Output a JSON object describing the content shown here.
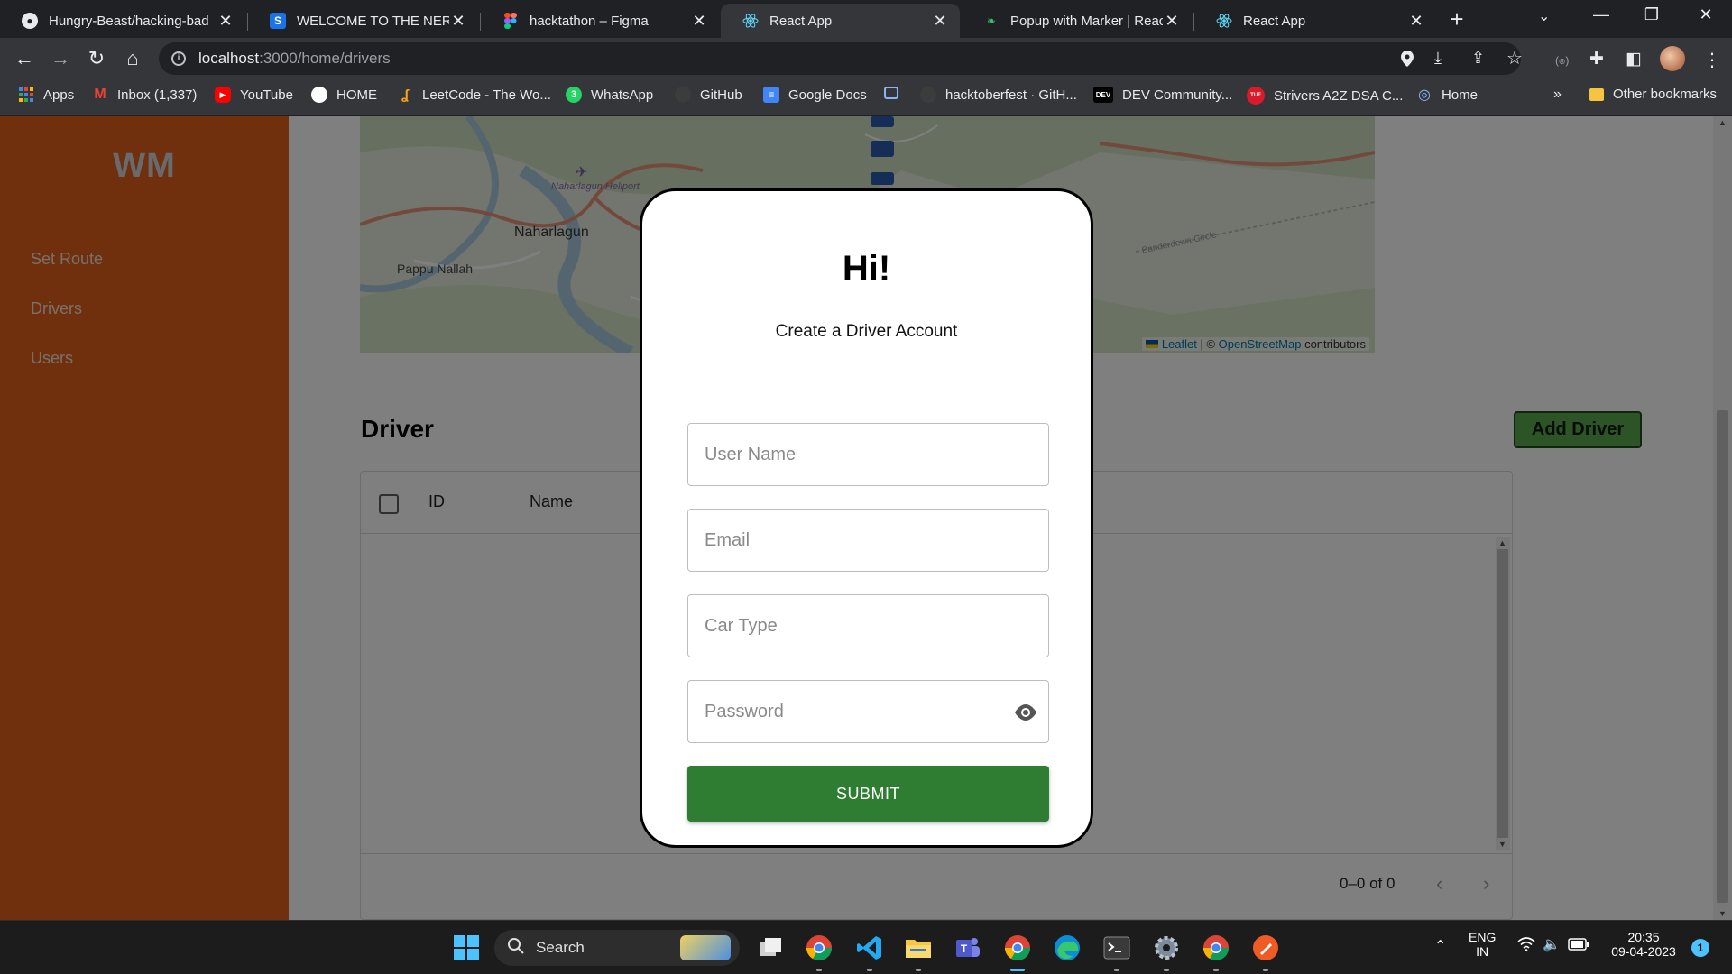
{
  "browser": {
    "tabs": [
      {
        "title": "Hungry-Beast/hacking-bad",
        "icon": "github-icon",
        "active": false
      },
      {
        "title": "WELCOME TO THE NERIST",
        "icon": "s-logo-icon",
        "active": false
      },
      {
        "title": "hacktathon – Figma",
        "icon": "figma-icon",
        "active": false
      },
      {
        "title": "React App",
        "icon": "react-icon",
        "active": true
      },
      {
        "title": "Popup with Marker | React",
        "icon": "leaf-icon",
        "active": false
      },
      {
        "title": "React App",
        "icon": "react-icon",
        "active": false
      }
    ],
    "url_host": "localhost",
    "url_path": ":3000/home/drivers",
    "bookmarks": [
      {
        "label": "Apps",
        "icon": "apps-grid-icon"
      },
      {
        "label": "Inbox (1,337)",
        "icon": "gmail-icon"
      },
      {
        "label": "YouTube",
        "icon": "youtube-icon"
      },
      {
        "label": "HOME",
        "icon": "home-circle-icon"
      },
      {
        "label": "LeetCode - The Wo...",
        "icon": "leetcode-icon"
      },
      {
        "label": "WhatsApp",
        "icon": "whatsapp-icon",
        "badge": "3"
      },
      {
        "label": "GitHub",
        "icon": "github-icon"
      },
      {
        "label": "Google Docs",
        "icon": "google-docs-icon"
      },
      {
        "label": "",
        "icon": "bookmark-square-icon"
      },
      {
        "label": "hacktoberfest · GitH...",
        "icon": "github-icon"
      },
      {
        "label": "DEV Community...",
        "icon": "dev-icon",
        "icon_text": "DEV"
      },
      {
        "label": "Strivers A2Z DSA C...",
        "icon": "tuf-icon",
        "icon_text": "TUF"
      },
      {
        "label": "Home",
        "icon": "home-swirl-icon"
      }
    ],
    "bookmarks_overflow": "»",
    "other_bookmarks": "Other bookmarks"
  },
  "app": {
    "logo": "WM",
    "nav": [
      "Set Route",
      "Drivers",
      "Users"
    ],
    "map": {
      "labels": [
        "Naharlagun Heliport",
        "Naharlagun",
        "Pappu Nallah",
        "Banderdewa Circle"
      ],
      "attribution_leaflet": "Leaflet",
      "attribution_sep": " | © ",
      "attribution_osm": "OpenStreetMap",
      "attribution_rest": " contributors"
    },
    "section_title": "Driver",
    "add_button": "Add Driver",
    "table": {
      "columns": [
        "ID",
        "Name"
      ],
      "pagination": "0–0 of 0"
    }
  },
  "modal": {
    "title": "Hi!",
    "subtitle": "Create a Driver Account",
    "fields": [
      {
        "placeholder": "User Name",
        "value": ""
      },
      {
        "placeholder": "Email",
        "value": ""
      },
      {
        "placeholder": "Car Type",
        "value": ""
      },
      {
        "placeholder": "Password",
        "value": ""
      }
    ],
    "submit": "SUBMIT"
  },
  "taskbar": {
    "search_label": "Search",
    "language": "ENG",
    "region": "IN",
    "time": "20:35",
    "date": "09-04-2023",
    "notification_count": "1",
    "apps": [
      "windows-start-icon",
      "search-icon",
      "widgets-icon",
      "task-view-icon",
      "chrome-icon",
      "vscode-icon",
      "file-explorer-icon",
      "teams-icon",
      "chrome-icon",
      "edge-icon",
      "terminal-icon",
      "settings-icon",
      "chrome-icon",
      "postman-icon"
    ]
  },
  "colors": {
    "sidebar": "#e0601a",
    "add_button": "#5aa84f",
    "submit": "#2e7d32"
  }
}
